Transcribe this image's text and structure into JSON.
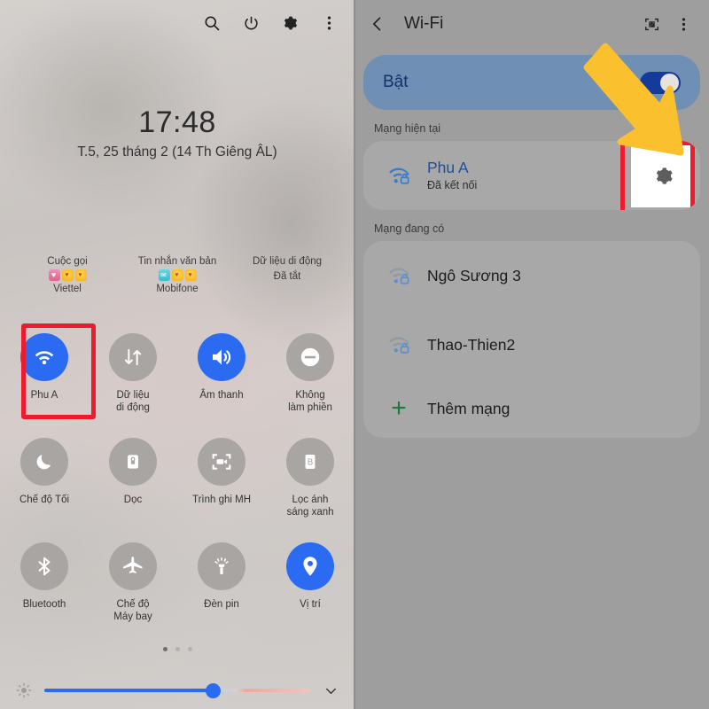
{
  "left_panel": {
    "topbar_icons": [
      {
        "name": "search-icon",
        "label": "Tìm kiếm"
      },
      {
        "name": "power-icon",
        "label": "Nguồn"
      },
      {
        "name": "gear-icon",
        "label": "Cài đặt"
      },
      {
        "name": "more-vert-icon",
        "label": "Tùy chọn khác"
      }
    ],
    "clock": {
      "time": "17:48",
      "date": "T.5, 25 tháng 2 (14 Th Giêng ÂL)"
    },
    "status_row": [
      {
        "title": "Cuộc gọi",
        "emoji": "call-heart",
        "sub": "Viettel"
      },
      {
        "title": "Tin nhắn văn bản",
        "emoji": "message",
        "sub": "Mobifone"
      },
      {
        "title": "Dữ liệu di động",
        "emoji": "",
        "sub": "Đã tắt"
      }
    ],
    "tiles": [
      {
        "label": "Phu A",
        "icon": "wifi-icon",
        "active": true,
        "highlighted": true
      },
      {
        "label": "Dữ liệu\ndi động",
        "icon": "data-arrows-icon",
        "active": false,
        "highlighted": false
      },
      {
        "label": "Âm thanh",
        "icon": "speaker-icon",
        "active": true,
        "highlighted": false
      },
      {
        "label": "Không\nlàm phiền",
        "icon": "minus-circle-icon",
        "active": false,
        "highlighted": false
      },
      {
        "label": "Chế độ Tối",
        "icon": "moon-icon",
        "active": false,
        "highlighted": false
      },
      {
        "label": "Dọc",
        "icon": "rotation-lock-icon",
        "active": false,
        "highlighted": false
      },
      {
        "label": "Trình ghi MH",
        "icon": "screen-record-icon",
        "active": false,
        "highlighted": false
      },
      {
        "label": "Lọc ánh\nsáng xanh",
        "icon": "blue-light-filter-icon",
        "active": false,
        "highlighted": false
      },
      {
        "label": "Bluetooth",
        "icon": "bluetooth-icon",
        "active": false,
        "highlighted": false
      },
      {
        "label": "Chế độ\nMáy bay",
        "icon": "airplane-icon",
        "active": false,
        "highlighted": false
      },
      {
        "label": "Đèn pin",
        "icon": "flashlight-icon",
        "active": false,
        "highlighted": false
      },
      {
        "label": "Vị trí",
        "icon": "location-pin-icon",
        "active": true,
        "highlighted": false
      }
    ],
    "page_dots": {
      "count": 3,
      "active_index": 0
    },
    "brightness": {
      "icon": "brightness-icon",
      "value_percent": 61,
      "expand_icon": "chevron-down-icon"
    }
  },
  "right_panel": {
    "header": {
      "back_icon": "back-arrow-icon",
      "title": "Wi-Fi",
      "qr_icon": "qr-scan-icon",
      "more_icon": "more-vert-icon"
    },
    "toggle": {
      "label": "Bật",
      "on": true
    },
    "current_section": {
      "title": "Mạng hiện tại",
      "network": {
        "name": "Phu A",
        "status": "Đã kết nối",
        "icon": "wifi-lock-icon",
        "gear_icon": "gear-icon",
        "gear_highlighted": true
      }
    },
    "available_section": {
      "title": "Mạng đang có",
      "networks": [
        {
          "name": "Ngô Sương 3",
          "icon": "wifi-lock-icon"
        },
        {
          "name": "Thao-Thien2",
          "icon": "wifi-lock-icon"
        }
      ],
      "add_network": {
        "label": "Thêm mạng",
        "icon": "plus-icon"
      }
    }
  },
  "annotations": {
    "arrow_color": "#FBC02D",
    "highlight_box_color": "#EC1C2E"
  }
}
